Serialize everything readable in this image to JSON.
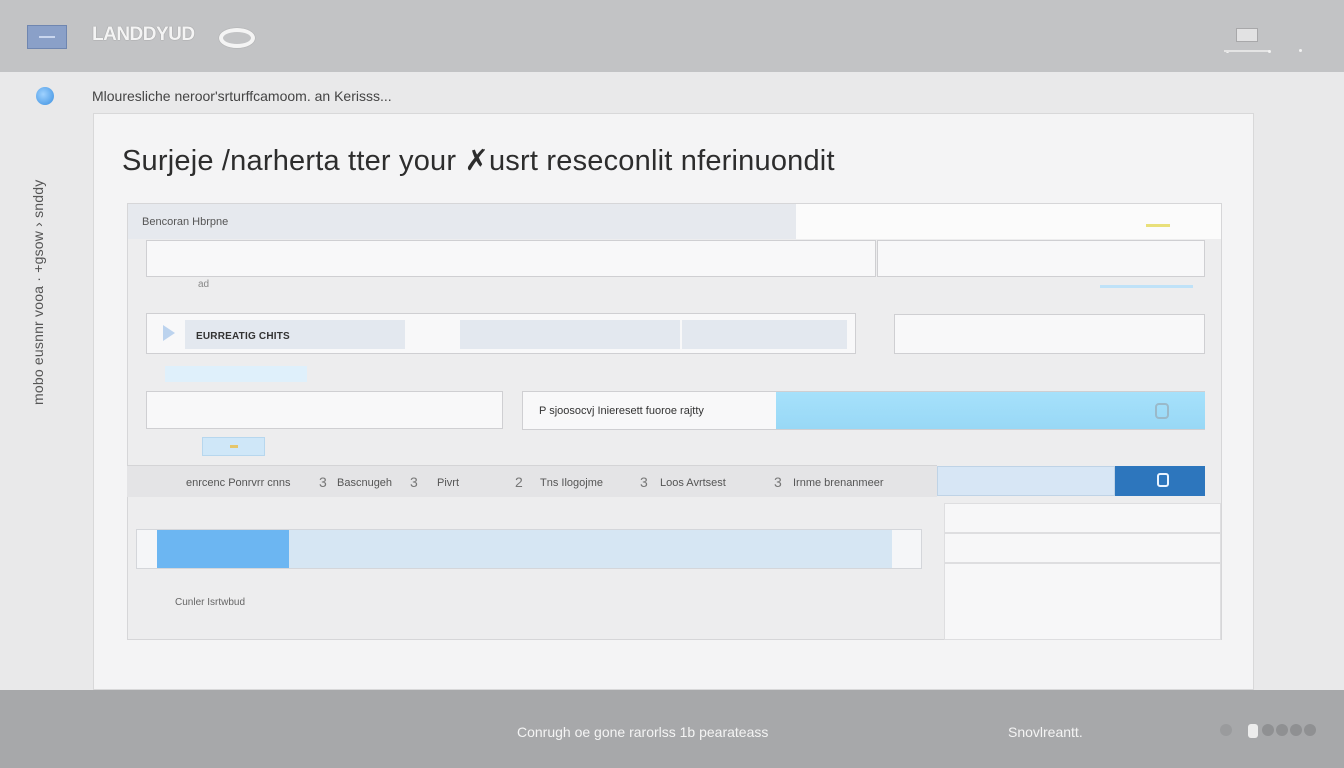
{
  "header": {
    "logo_text": "LANDDYUD",
    "flag_icon": "flag-icon",
    "ring_icon": "ring-logo-icon"
  },
  "sidebar": {
    "vertical_label": "mobo eusnnr vooa · +gsow › snddy",
    "dot_icon": "globe-icon"
  },
  "breadcrumb": "Mlouresliche neroor'srturffcamoom. an Kerisss...",
  "main": {
    "title": "Surjeje /narherta  tter  your  ✗usrt  reseconlit  nferinuondit",
    "panel_label": "Bencoran Hbrpne",
    "field_small_label": "ad",
    "chip_label": "EURREATIG CHITS",
    "select_text": "P  sjoosocvj  Inieresett fuoroe rajtty",
    "progress_caption": "Cunler Isrtwbud",
    "progress_value": 0.18
  },
  "tabs": {
    "items": [
      {
        "num": "",
        "label": "enrcenc  Ponrvrr  cnns"
      },
      {
        "num": "3",
        "label": "Bascnugeh"
      },
      {
        "num": "3",
        "label": "Pivrt"
      },
      {
        "num": "2",
        "label": "Tns Ilogojme"
      },
      {
        "num": "3",
        "label": "Loos Avrtsest"
      },
      {
        "num": "3",
        "label": "Irnme brenanmeer"
      }
    ]
  },
  "footer": {
    "copyright": "Conrugh oe gone rarorlss   1b pearateass",
    "right_link": "Snovlreantt."
  },
  "colors": {
    "accent_blue": "#2d76bd",
    "light_blue": "#a6e1fb",
    "progress_blue": "#6cb6f2"
  }
}
